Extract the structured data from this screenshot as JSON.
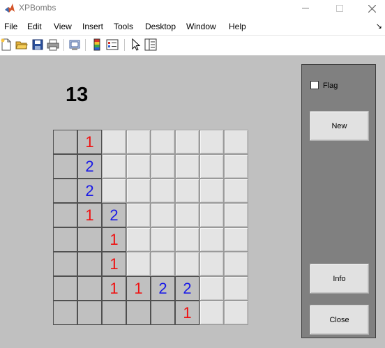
{
  "window": {
    "title": "XPBombs"
  },
  "menu": {
    "items": [
      "File",
      "Edit",
      "View",
      "Insert",
      "Tools",
      "Desktop",
      "Window",
      "Help"
    ]
  },
  "game": {
    "mine_counter": "13",
    "rows": [
      [
        "",
        "1",
        null,
        null,
        null,
        null,
        null,
        null
      ],
      [
        "",
        "2",
        null,
        null,
        null,
        null,
        null,
        null
      ],
      [
        "",
        "2",
        null,
        null,
        null,
        null,
        null,
        null
      ],
      [
        "",
        "1",
        "2",
        null,
        null,
        null,
        null,
        null
      ],
      [
        "",
        "",
        "1",
        null,
        null,
        null,
        null,
        null
      ],
      [
        "",
        "",
        "1",
        null,
        null,
        null,
        null,
        null
      ],
      [
        "",
        "",
        "1",
        "1",
        "2",
        "2",
        null,
        null
      ],
      [
        "",
        "",
        "",
        "",
        "",
        "1",
        null,
        null
      ]
    ],
    "number_colors": {
      "1": "#ee1111",
      "2": "#1a1ae6"
    }
  },
  "panel": {
    "flag_label": "Flag",
    "flag_checked": false,
    "new_label": "New",
    "info_label": "Info",
    "close_label": "Close"
  }
}
